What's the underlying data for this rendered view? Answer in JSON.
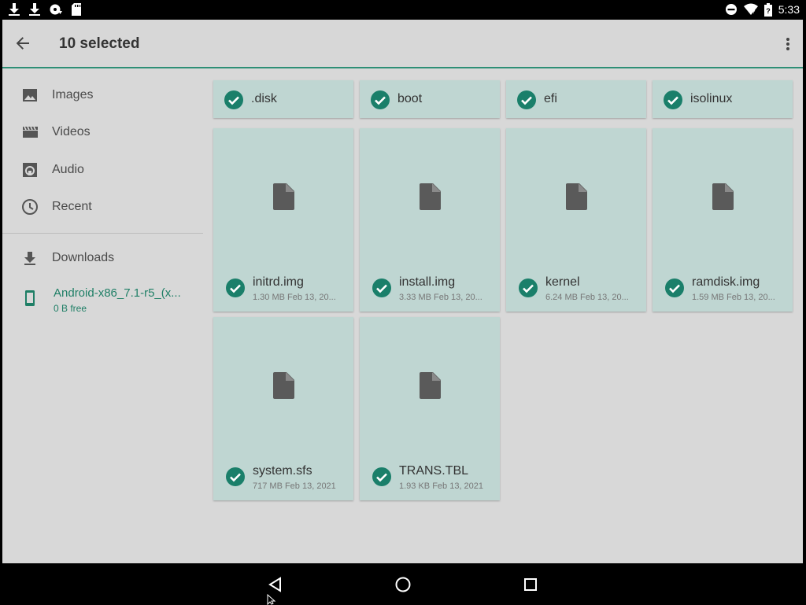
{
  "status_bar": {
    "left_icons": [
      "download-icon",
      "download-icon",
      "sync-disc-icon",
      "sd-card-icon"
    ],
    "right_icons": [
      "do-not-disturb-icon",
      "wifi-icon",
      "battery-icon"
    ],
    "time": "5:33"
  },
  "toolbar": {
    "title": "10 selected",
    "back_icon": "arrow-back-icon",
    "more_icon": "more-vert-icon"
  },
  "drawer": {
    "roots": [
      {
        "label": "Images",
        "icon": "image-icon"
      },
      {
        "label": "Videos",
        "icon": "movie-icon"
      },
      {
        "label": "Audio",
        "icon": "audio-icon"
      },
      {
        "label": "Recent",
        "icon": "clock-icon"
      }
    ],
    "downloads": {
      "label": "Downloads",
      "icon": "download-icon"
    },
    "device": {
      "name": "Android-x86_7.1-r5_(x...",
      "free": "0 B free",
      "icon": "phone-icon"
    }
  },
  "folders": [
    {
      "name": ".disk",
      "selected": true
    },
    {
      "name": "boot",
      "selected": true
    },
    {
      "name": "efi",
      "selected": true
    },
    {
      "name": "isolinux",
      "selected": true
    }
  ],
  "files": [
    {
      "name": "initrd.img",
      "meta": "1.30 MB Feb 13, 20...",
      "selected": true
    },
    {
      "name": "install.img",
      "meta": "3.33 MB Feb 13, 20...",
      "selected": true
    },
    {
      "name": "kernel",
      "meta": "6.24 MB Feb 13, 20...",
      "selected": true
    },
    {
      "name": "ramdisk.img",
      "meta": "1.59 MB Feb 13, 20...",
      "selected": true
    },
    {
      "name": "system.sfs",
      "meta": "717 MB Feb 13, 2021",
      "selected": true
    },
    {
      "name": "TRANS.TBL",
      "meta": "1.93 KB Feb 13, 2021",
      "selected": true
    }
  ],
  "nav_bar": {
    "buttons": [
      "back-icon",
      "home-icon",
      "recents-icon"
    ]
  },
  "colors": {
    "accent": "#2e8f76",
    "check": "#1a7f6a",
    "tile_selected": "#bfd6d2",
    "background": "#d8d8d8"
  }
}
